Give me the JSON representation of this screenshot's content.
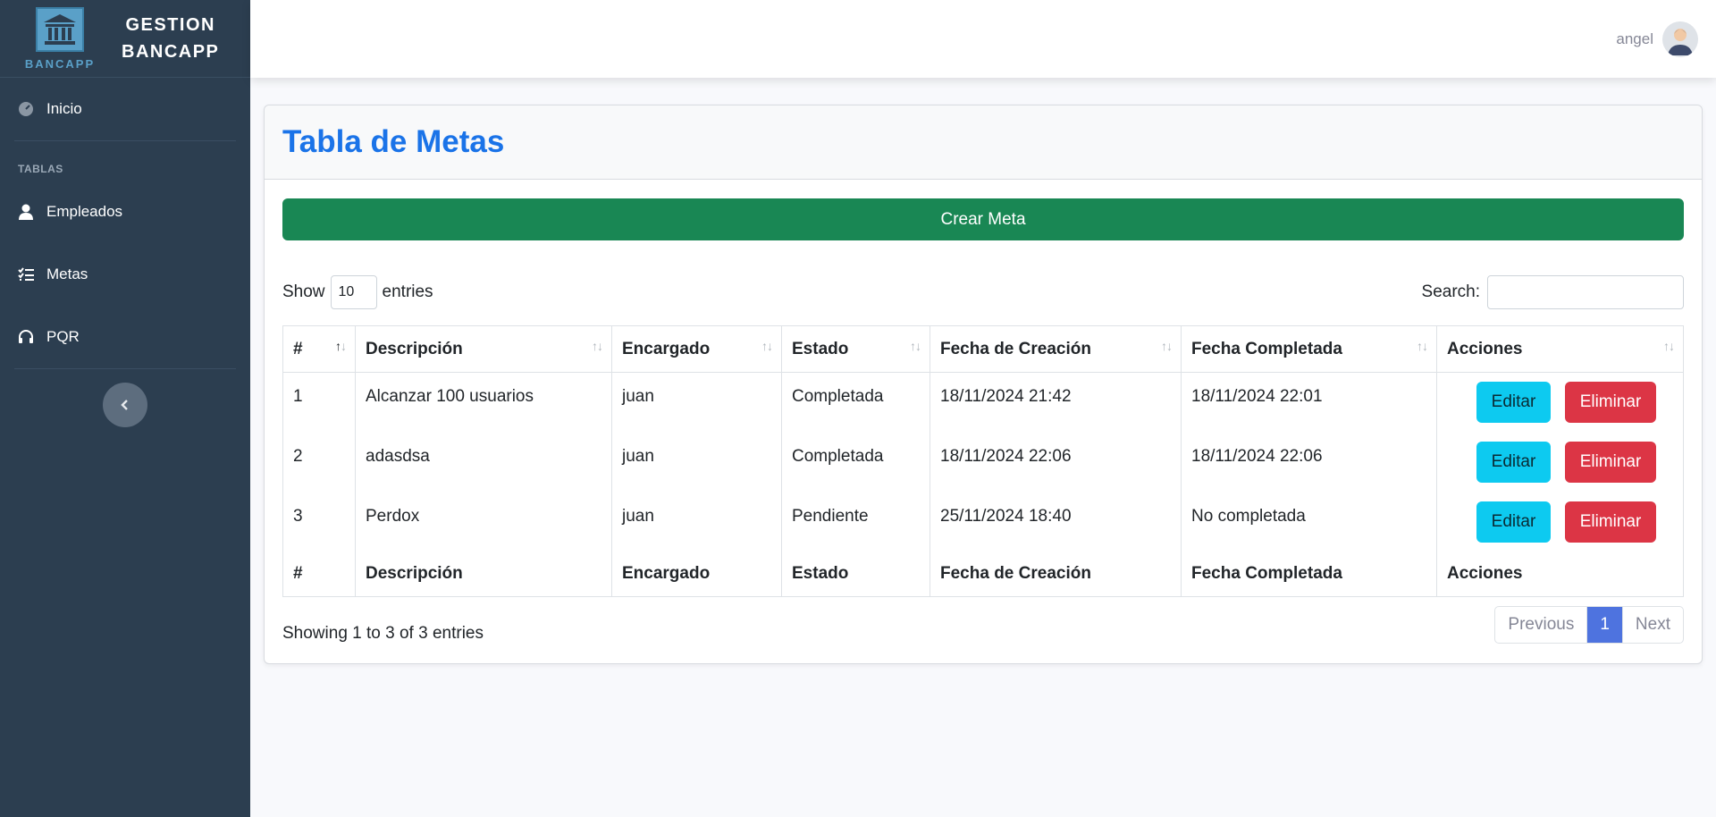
{
  "sidebar": {
    "logo_text": "BANCAPP",
    "brand_line1": "GESTION",
    "brand_line2": "BANCAPP",
    "home_label": "Inicio",
    "section_heading": "TABLAS",
    "items": [
      {
        "label": "Empleados",
        "icon": "user-icon"
      },
      {
        "label": "Metas",
        "icon": "list-check-icon"
      },
      {
        "label": "PQR",
        "icon": "headset-icon"
      }
    ]
  },
  "topbar": {
    "username": "angel"
  },
  "page": {
    "title": "Tabla de Metas",
    "create_button": "Crear Meta",
    "show_label": "Show",
    "entries_label": "entries",
    "page_length": "10",
    "search_label": "Search:",
    "search_value": ""
  },
  "table": {
    "columns": [
      "#",
      "Descripción",
      "Encargado",
      "Estado",
      "Fecha de Creación",
      "Fecha Completada",
      "Acciones"
    ],
    "rows": [
      {
        "id": "1",
        "descripcion": "Alcanzar 100 usuarios",
        "encargado": "juan",
        "estado": "Completada",
        "creacion": "18/11/2024 21:42",
        "completada": "18/11/2024 22:01"
      },
      {
        "id": "2",
        "descripcion": "adasdsa",
        "encargado": "juan",
        "estado": "Completada",
        "creacion": "18/11/2024 22:06",
        "completada": "18/11/2024 22:06"
      },
      {
        "id": "3",
        "descripcion": "Perdox",
        "encargado": "juan",
        "estado": "Pendiente",
        "creacion": "25/11/2024 18:40",
        "completada": "No completada"
      }
    ],
    "edit_label": "Editar",
    "delete_label": "Eliminar"
  },
  "footer": {
    "info": "Showing 1 to 3 of 3 entries",
    "previous": "Previous",
    "current_page": "1",
    "next": "Next"
  },
  "colors": {
    "sidebar": "#2c3e50",
    "title": "#1a73e8",
    "create": "#198754",
    "edit": "#0dcaf0",
    "delete": "#dc3545",
    "page_active": "#4e73df"
  }
}
